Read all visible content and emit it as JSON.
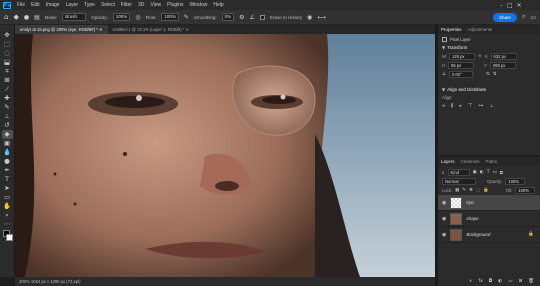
{
  "menu": {
    "app_badge": "Ps",
    "items": [
      "File",
      "Edit",
      "Image",
      "Layer",
      "Type",
      "Select",
      "Filter",
      "3D",
      "View",
      "Plugins",
      "Window",
      "Help"
    ]
  },
  "options_bar": {
    "mode_label": "Mode:",
    "mode_value": "Brush",
    "opacity_label": "Opacity:",
    "opacity_value": "100%",
    "flow_label": "Flow:",
    "flow_value": "100%",
    "smoothing_label": "Smoothing:",
    "smoothing_value": "0%",
    "erase_history_label": "Erase to History",
    "share_label": "Share"
  },
  "tabs": [
    {
      "label": "emilyr at 15.png @ 200% (eye, RGB/8#) *",
      "active": true
    },
    {
      "label": "Untitled-1 @ 72.1% (Layer 1, RGB/8) *",
      "active": false
    }
  ],
  "status": {
    "text": "200%   1024 px x 1280 px (72 ppi)"
  },
  "properties": {
    "tab_properties": "Properties",
    "tab_adjustments": "Adjustments",
    "layer_kind": "Pixel Layer",
    "transform_title": "Transform",
    "w_label": "W",
    "w_value": "128 px",
    "h_label": "H",
    "h_value": "85 px",
    "x_label": "X",
    "x_value": "632 px",
    "y_label": "Y",
    "y_value": "268 px",
    "angle_value": "0.00°",
    "align_title": "Align and Distribute",
    "align_label": "Align:"
  },
  "layers": {
    "tab_layers": "Layers",
    "tab_channels": "Channels",
    "tab_paths": "Paths",
    "filter_kind": "Kind",
    "blend_mode": "Normal",
    "opacity_label": "Opacity:",
    "opacity_value": "100%",
    "lock_label": "Lock:",
    "fill_label": "Fill:",
    "fill_value": "100%",
    "items": [
      {
        "name": "eye",
        "selected": true
      },
      {
        "name": "shape",
        "selected": false
      },
      {
        "name": "Background",
        "selected": false
      }
    ]
  },
  "colors": {
    "accent": "#1473e6",
    "panel_bg": "#2b2b2b",
    "app_bg": "#1e1e1e"
  }
}
